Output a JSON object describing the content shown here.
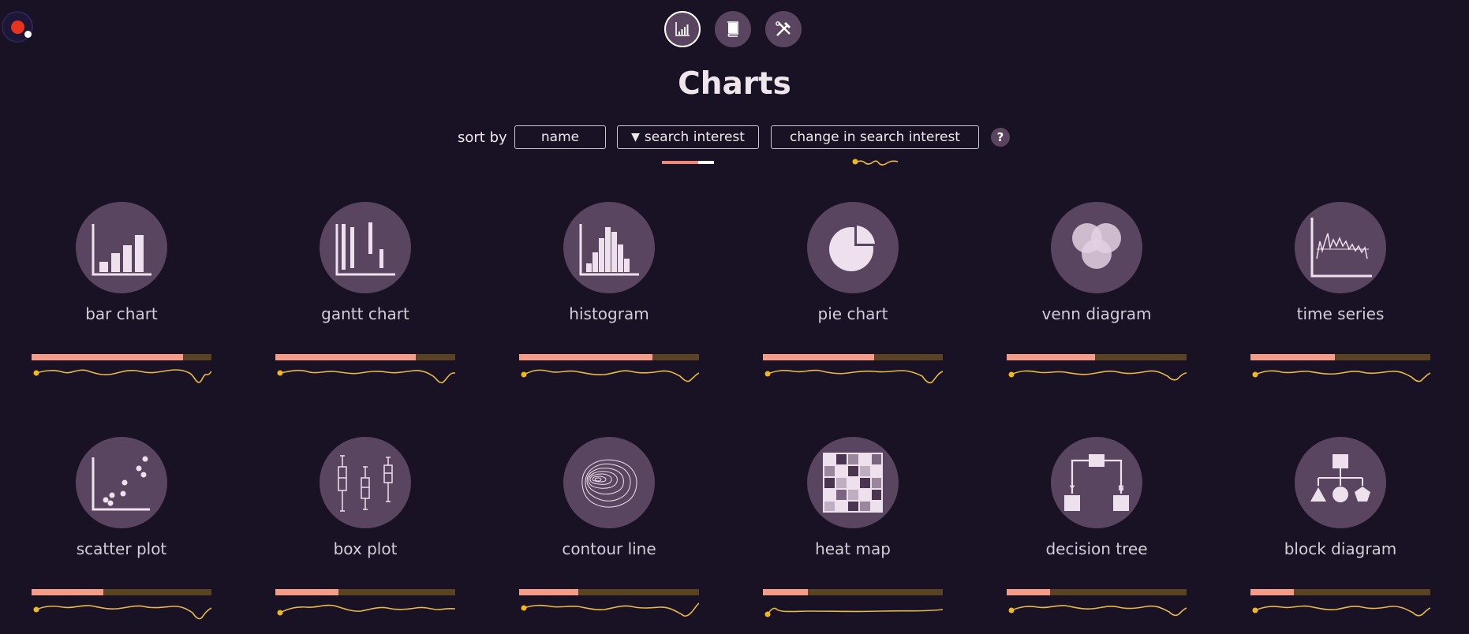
{
  "page": {
    "title": "Charts"
  },
  "nav": {
    "buttons": [
      {
        "icon": "bar-chart-icon",
        "active": true
      },
      {
        "icon": "book-icon",
        "active": false
      },
      {
        "icon": "tools-icon",
        "active": false
      }
    ]
  },
  "sort": {
    "label": "sort by",
    "options": [
      {
        "label": "name",
        "selected": false
      },
      {
        "label": "search interest",
        "selected": true,
        "indicator": "▼"
      },
      {
        "label": "change in search interest",
        "selected": false
      }
    ],
    "help": "?"
  },
  "colors": {
    "background": "#181224",
    "icon_circle": "#5a4560",
    "bar_fill": "#f59c86",
    "bar_track": "#5a4322",
    "sparkline": "#e8b84a",
    "record": "#e8331e"
  },
  "charts": [
    {
      "name": "bar chart",
      "icon": "bar-chart-icon",
      "search_interest": 0.84
    },
    {
      "name": "gantt chart",
      "icon": "gantt-chart-icon",
      "search_interest": 0.78
    },
    {
      "name": "histogram",
      "icon": "histogram-icon",
      "search_interest": 0.74
    },
    {
      "name": "pie chart",
      "icon": "pie-chart-icon",
      "search_interest": 0.62
    },
    {
      "name": "venn diagram",
      "icon": "venn-diagram-icon",
      "search_interest": 0.49
    },
    {
      "name": "time series",
      "icon": "time-series-icon",
      "search_interest": 0.47
    },
    {
      "name": "scatter plot",
      "icon": "scatter-plot-icon",
      "search_interest": 0.4
    },
    {
      "name": "box plot",
      "icon": "box-plot-icon",
      "search_interest": 0.35
    },
    {
      "name": "contour line",
      "icon": "contour-line-icon",
      "search_interest": 0.33
    },
    {
      "name": "heat map",
      "icon": "heat-map-icon",
      "search_interest": 0.25
    },
    {
      "name": "decision tree",
      "icon": "decision-tree-icon",
      "search_interest": 0.24
    },
    {
      "name": "block diagram",
      "icon": "block-diagram-icon",
      "search_interest": 0.24
    }
  ]
}
